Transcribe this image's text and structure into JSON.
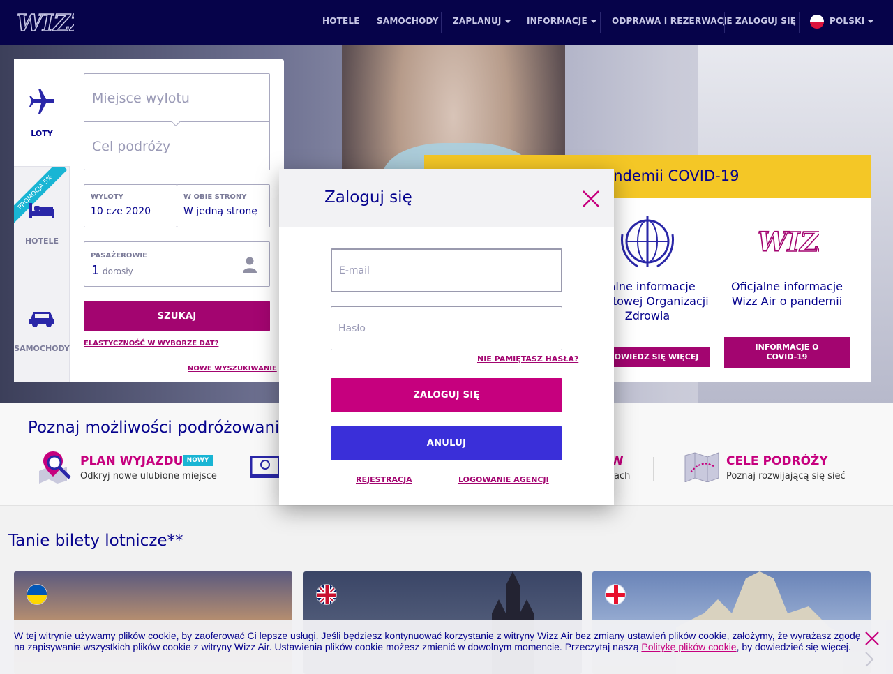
{
  "nav": {
    "items": [
      "HOTELE",
      "SAMOCHODY",
      "ZAPLANUJ",
      "INFORMACJE",
      "ODPRAWA I REZERWACJE",
      "ZALOGUJ SIĘ"
    ],
    "language": "POLSKI"
  },
  "search": {
    "tabs": [
      "LOTY",
      "HOTELE",
      "SAMOCHODY"
    ],
    "promo": "PROMOCJA 5%",
    "departure_placeholder": "Miejsce wylotu",
    "destination_placeholder": "Cel podróży",
    "departures_label": "WYLOTY",
    "departures_value": "10 cze 2020",
    "return_label": "W OBIE STRONY",
    "return_value": "W jedną stronę",
    "passengers_label": "PASAŻEROWIE",
    "passengers_count": "1",
    "passengers_unit": "dorosły",
    "search_button": "SZUKAJ",
    "flex_link": "ELASTYCZNOŚĆ W WYBORZE DAT?",
    "new_search_link": "NOWE WYSZUKIWANIE"
  },
  "covid": {
    "title": "cje o pandemii COVID-19",
    "who_text": "cjalne informacje\nŚwiatowej Organizacji\nZdrowia",
    "who_button": "OWIEDZ SIĘ WIĘCEJ",
    "wizz_text": "Oficjalne informacje\nWizz Air o pandemii",
    "wizz_button": "INFORMACJE O COVID-19"
  },
  "discover": {
    "title": "Poznaj możliwości podróżowania",
    "plan_title": "PLAN WYJAZDU",
    "plan_badge": "NOWY",
    "plan_sub": "Odkryj nowe ulubione miejsce",
    "partial_title": "W",
    "partial_sub": "ach",
    "dest_title": "CELE PODRÓŻY",
    "dest_sub": "Poznaj rozwijającą się sieć"
  },
  "cheap": {
    "title": "Tanie bilety lotnicze**"
  },
  "cookie": {
    "text": "W tej witrynie używamy plików cookie, by zaoferować Ci lepsze usługi. Jeśli będziesz kontynuować korzystanie z witryny Wizz Air bez zmiany ustawień plików cookie, założymy, że wyrażasz zgodę na zapisywanie wszystkich plików cookie z witryny Wizz Air. Ustawienia plików cookie możesz zmienić w dowolnym momencie. Przeczytaj naszą ",
    "link": "Politykę plików cookie",
    "tail": ", by dowiedzieć się więcej."
  },
  "modal": {
    "title": "Zaloguj się",
    "email_placeholder": "E-mail",
    "password_placeholder": "Hasło",
    "forgot": "NIE PAMIĘTASZ HASŁA?",
    "login_button": "ZALOGUJ SIĘ",
    "cancel_button": "ANULUJ",
    "register": "REJESTRACJA",
    "agency": "LOGOWANIE AGENCJI"
  },
  "colors": {
    "navy": "#06034a",
    "magenta": "#c6007e",
    "blue_button": "#3a2fd9",
    "covid_yellow": "#f4c726"
  }
}
